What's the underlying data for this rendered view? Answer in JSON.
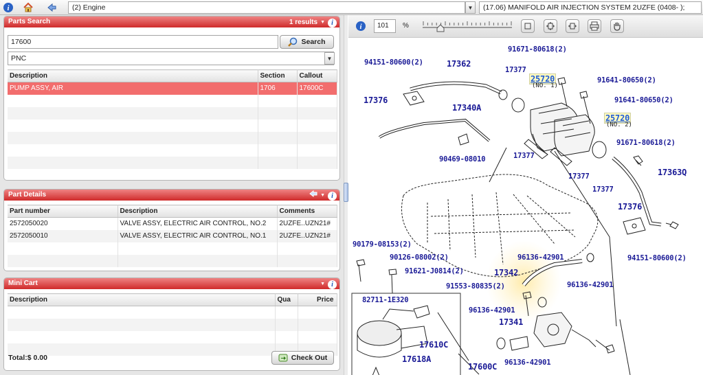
{
  "top_bar": {
    "engine_select": "(2) Engine",
    "diagram_select": "(17.06) MANIFOLD AIR INJECTION SYSTEM 2UZFE (0408- );"
  },
  "parts_search": {
    "title": "Parts Search",
    "result_count": "1 results",
    "query": "17600",
    "search_label": "Search",
    "type_select": "PNC",
    "columns": [
      "Description",
      "Section",
      "Callout"
    ],
    "rows": [
      {
        "description": "PUMP ASSY, AIR",
        "section": "1706",
        "callout": "17600C"
      }
    ]
  },
  "part_details": {
    "title": "Part Details",
    "columns": [
      "Part number",
      "Description",
      "Comments"
    ],
    "rows": [
      {
        "part_number": "2572050020",
        "description": "VALVE ASSY, ELECTRIC AIR CONTROL, NO.2",
        "comments": "2UZFE..UZN21#"
      },
      {
        "part_number": "2572050010",
        "description": "VALVE ASSY, ELECTRIC AIR CONTROL, NO.1",
        "comments": "2UZFE..UZN21#"
      }
    ]
  },
  "mini_cart": {
    "title": "Mini Cart",
    "columns": [
      "Description",
      "Qua",
      "Price"
    ],
    "total": "Total:$ 0.00",
    "checkout_label": "Check Out"
  },
  "diagram_toolbar": {
    "zoom_value": "101",
    "zoom_unit": "%",
    "zoom_fraction": 0.2
  },
  "diagram": {
    "labels": [
      {
        "id": "l1",
        "text": "91671-80618(2)"
      },
      {
        "id": "l2",
        "text": "94151-80600(2)"
      },
      {
        "id": "l3",
        "text": "17362"
      },
      {
        "id": "l4",
        "text": "17377"
      },
      {
        "id": "l5",
        "text": "25720"
      },
      {
        "id": "l6",
        "text": "(NO. 1)"
      },
      {
        "id": "l7",
        "text": "91641-80650(2)"
      },
      {
        "id": "l8",
        "text": "17376"
      },
      {
        "id": "l9",
        "text": "91641-80650(2)"
      },
      {
        "id": "l10",
        "text": "17340A"
      },
      {
        "id": "l11",
        "text": "25720"
      },
      {
        "id": "l12",
        "text": "(NO. 2)"
      },
      {
        "id": "l13",
        "text": "91671-80618(2)"
      },
      {
        "id": "l14",
        "text": "17377"
      },
      {
        "id": "l15",
        "text": "90469-08010"
      },
      {
        "id": "l16",
        "text": "17377"
      },
      {
        "id": "l17",
        "text": "17363Q"
      },
      {
        "id": "l18",
        "text": "17377"
      },
      {
        "id": "l19",
        "text": "17376"
      },
      {
        "id": "l20",
        "text": "90179-08153(2)"
      },
      {
        "id": "l21",
        "text": "90126-08002(2)"
      },
      {
        "id": "l22",
        "text": "96136-42901"
      },
      {
        "id": "l23",
        "text": "94151-80600(2)"
      },
      {
        "id": "l24",
        "text": "91621-J0814(2)"
      },
      {
        "id": "l25",
        "text": "17342"
      },
      {
        "id": "l26",
        "text": "91553-80835(2)"
      },
      {
        "id": "l27",
        "text": "96136-42901"
      },
      {
        "id": "l28",
        "text": "82711-1E320"
      },
      {
        "id": "l29",
        "text": "96136-42901"
      },
      {
        "id": "l30",
        "text": "17341"
      },
      {
        "id": "l31",
        "text": "17610C"
      },
      {
        "id": "l32",
        "text": "17618A"
      },
      {
        "id": "l33",
        "text": "17600C"
      },
      {
        "id": "l34",
        "text": "96136-42901"
      }
    ]
  },
  "colors": {
    "panel_header": "#cf2b2b",
    "selected_row": "#f26d6d",
    "label_text": "#1a1a96",
    "highlight_bg": "#fffbc2"
  }
}
